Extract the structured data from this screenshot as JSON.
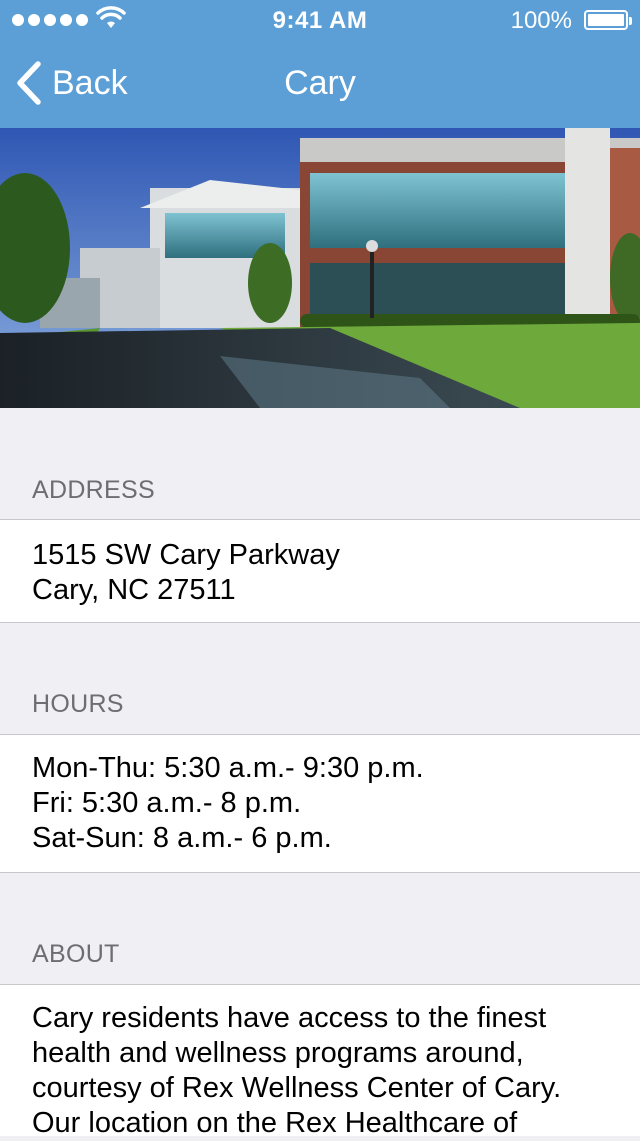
{
  "status_bar": {
    "time": "9:41 AM",
    "battery": "100%"
  },
  "nav": {
    "back_label": "Back",
    "title": "Cary"
  },
  "address": {
    "header": "ADDRESS",
    "lines": [
      "1515 SW Cary Parkway",
      "Cary, NC 27511"
    ]
  },
  "hours": {
    "header": "HOURS",
    "lines": [
      "Mon-Thu: 5:30 a.m.- 9:30 p.m.",
      "Fri: 5:30 a.m.- 8 p.m.",
      "Sat-Sun: 8 a.m.- 6 p.m."
    ]
  },
  "about": {
    "header": "ABOUT",
    "lines": [
      "Cary residents have access to the finest",
      "health and wellness programs around,",
      "courtesy of Rex Wellness Center of Cary.",
      "Our location on the Rex Healthcare of"
    ]
  },
  "colors": {
    "nav_bar": "#5b9fd6",
    "background": "#efeff4",
    "section_header": "#6d6d72"
  }
}
